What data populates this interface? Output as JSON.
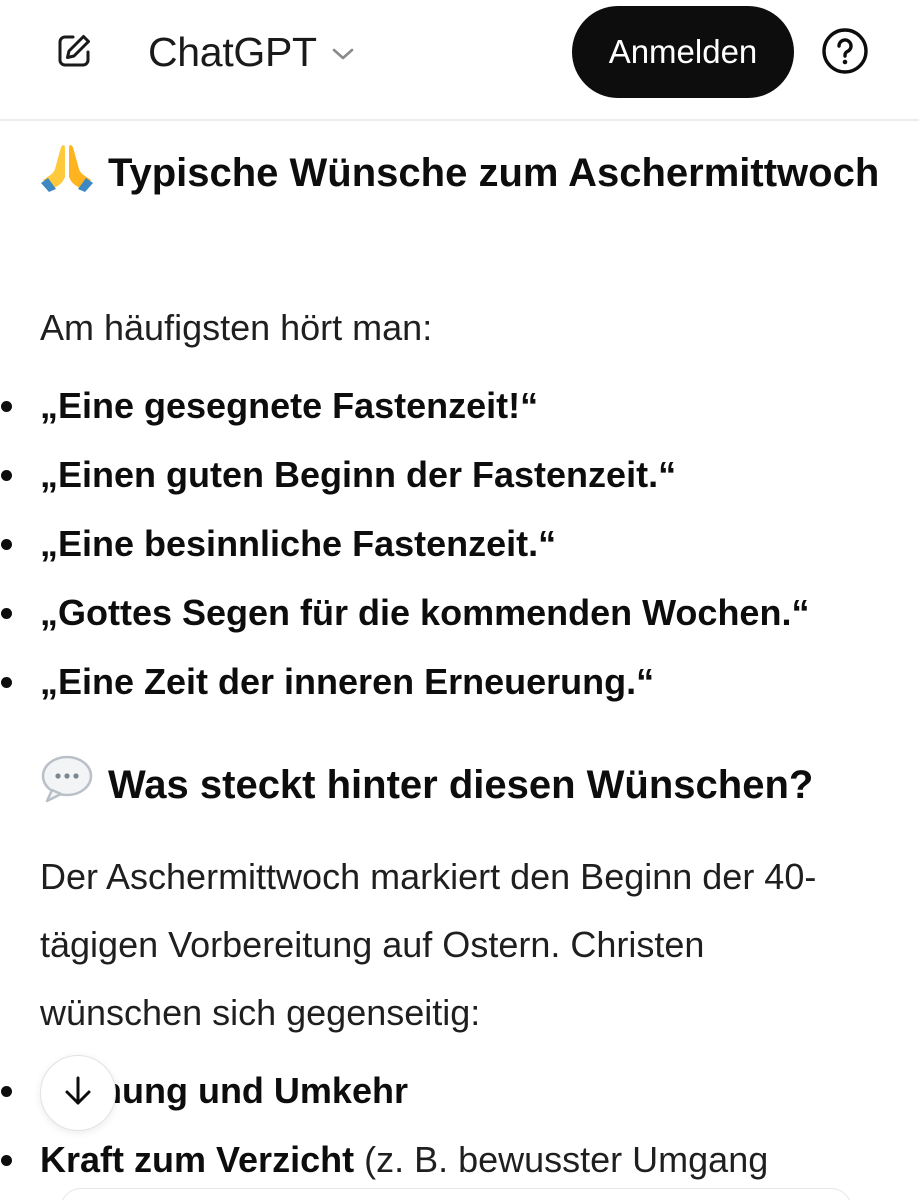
{
  "header": {
    "model_name": "ChatGPT",
    "login_label": "Anmelden",
    "icons": {
      "edit": "new-chat-icon",
      "chevron": "chevron-down-icon",
      "help": "help-icon"
    }
  },
  "sections": [
    {
      "emoji": "🙏",
      "heading": "Typische Wünsche zum Aschermittwoch",
      "intro": "Am häufigsten hört man:",
      "wishes": [
        "„Eine gesegnete Fastenzeit!“",
        "„Einen guten Beginn der Fastenzeit.“",
        "„Eine besinnliche Fastenzeit.“",
        "„Gottes Segen für die kommenden Wochen.“",
        "„Eine Zeit der inneren Erneuerung.“"
      ]
    },
    {
      "emoji": "💬",
      "heading": "Was steckt hinter diesen Wünschen?",
      "intro": "Der Aschermittwoch markiert den Beginn der 40-tägigen Vorbereitung auf Ostern. Christen wünschen sich gegenseitig:",
      "items": [
        {
          "bold": "innung und Umkehr",
          "rest": ""
        },
        {
          "bold": "Kraft zum Verzicht",
          "rest": " (z. B. bewusster Umgang"
        }
      ]
    }
  ],
  "colors": {
    "button_bg": "#0d0d0d",
    "button_text": "#ffffff",
    "text": "#0d0d0d",
    "divider": "#ececec"
  }
}
